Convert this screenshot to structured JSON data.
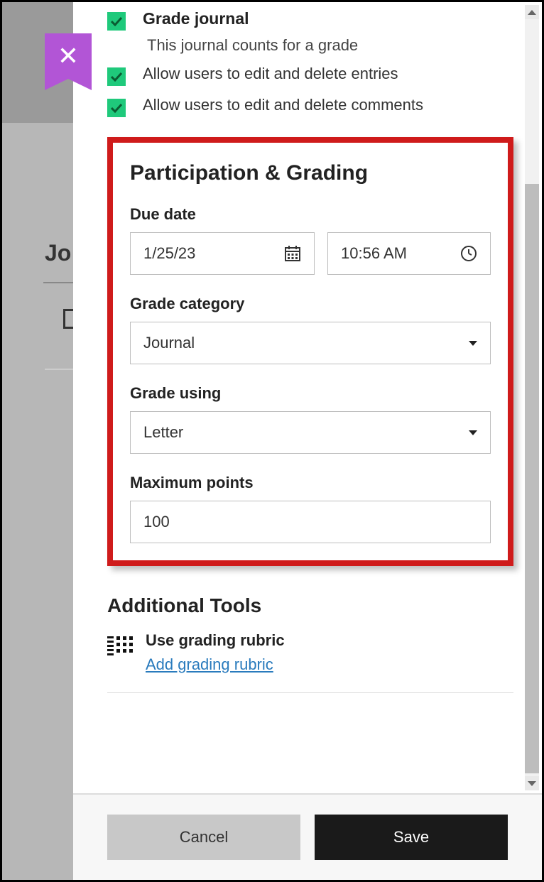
{
  "bg": {
    "jo": "Jo"
  },
  "options": {
    "grade_journal_label": "Grade journal",
    "grade_journal_sub": "This journal counts for a grade",
    "allow_edit_entries": "Allow users to edit and delete entries",
    "allow_edit_comments": "Allow users to edit and delete comments"
  },
  "section": {
    "title": "Participation & Grading",
    "due_date_label": "Due date",
    "due_date_value": "1/25/23",
    "due_time_value": "10:56 AM",
    "grade_category_label": "Grade category",
    "grade_category_value": "Journal",
    "grade_using_label": "Grade using",
    "grade_using_value": "Letter",
    "max_points_label": "Maximum points",
    "max_points_value": "100"
  },
  "tools": {
    "title": "Additional Tools",
    "rubric_label": "Use grading rubric",
    "rubric_link": "Add grading rubric"
  },
  "footer": {
    "cancel": "Cancel",
    "save": "Save"
  }
}
